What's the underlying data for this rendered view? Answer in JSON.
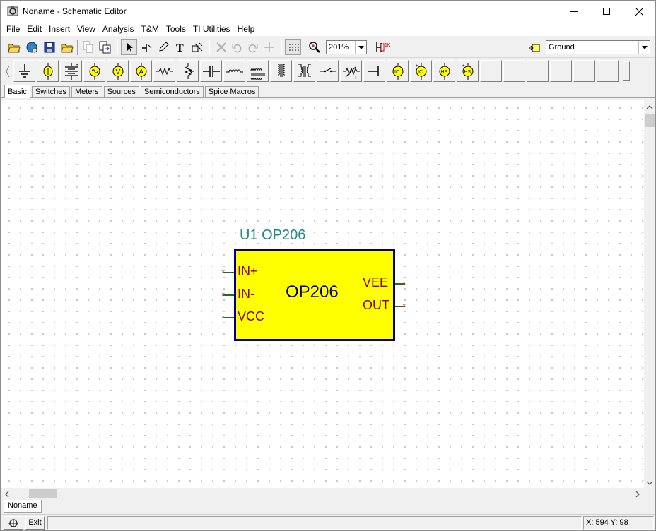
{
  "window": {
    "title": "Noname - Schematic Editor"
  },
  "menu": [
    "File",
    "Edit",
    "Insert",
    "View",
    "Analysis",
    "T&M",
    "Tools",
    "TI Utilities",
    "Help"
  ],
  "toolbar": {
    "zoom_value": "201%",
    "component_select_value": "Ground"
  },
  "palette_tabs": [
    "Basic",
    "Switches",
    "Meters",
    "Sources",
    "Semiconductors",
    "Spice Macros"
  ],
  "palette_tab_active": "Basic",
  "schematic": {
    "component_label": "U1 OP206",
    "body_label": "OP206",
    "left_pins": [
      "IN+",
      "IN-",
      "VCC"
    ],
    "right_pins": [
      "VEE",
      "OUT"
    ],
    "pin_marker": "×",
    "body_color": "#ffff00",
    "border_color": "#000080",
    "label_color": "#1a8a8a",
    "pin_text_color": "#8b0000"
  },
  "document_tab": "Noname",
  "status": {
    "exit_label": "Exit",
    "coords": "X: 594  Y: 98"
  }
}
